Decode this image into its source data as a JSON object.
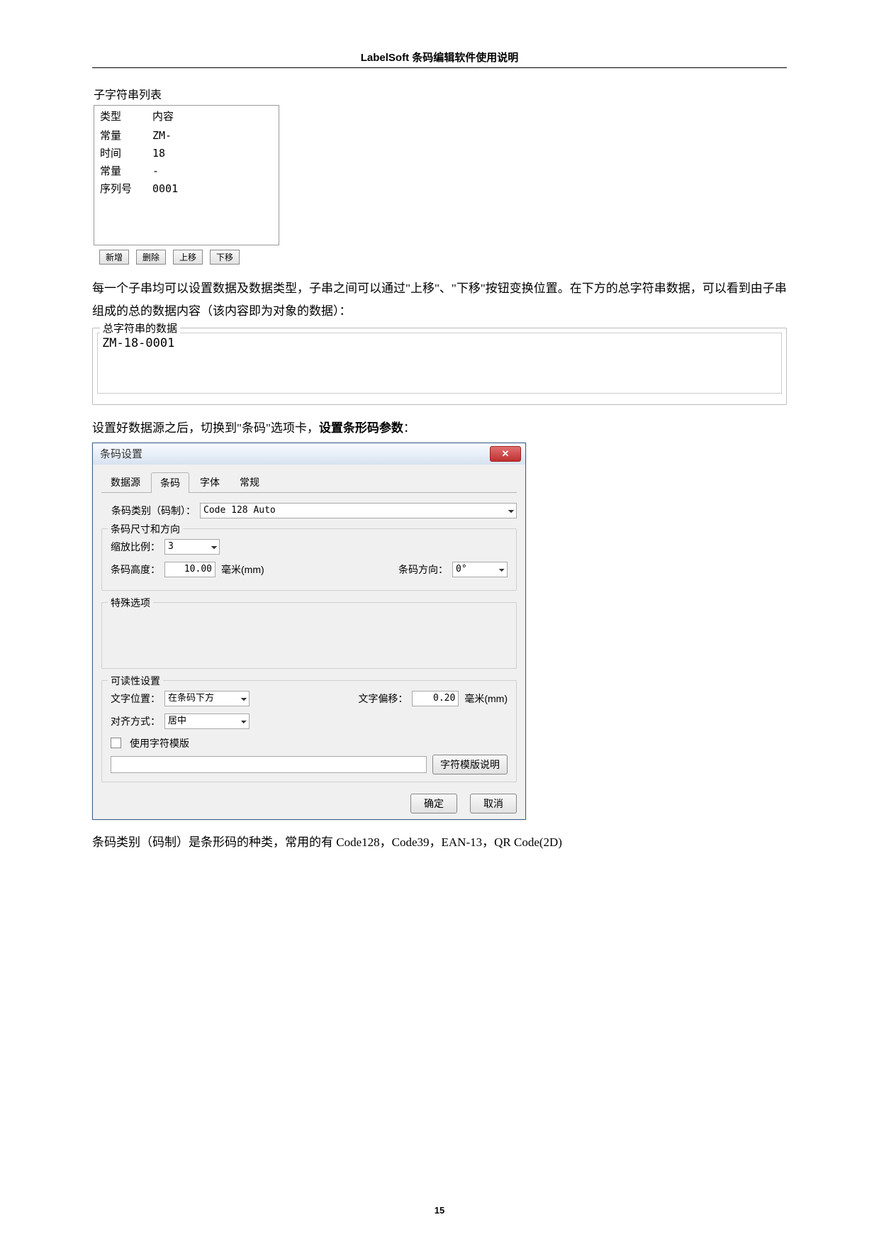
{
  "header": "LabelSoft 条码编辑软件使用说明",
  "substring": {
    "title": "子字符串列表",
    "columns": {
      "type": "类型",
      "content": "内容"
    },
    "rows": [
      {
        "type": "常量",
        "content": "ZM-"
      },
      {
        "type": "时间",
        "content": "18"
      },
      {
        "type": "常量",
        "content": "-"
      },
      {
        "type": "序列号",
        "content": "0001"
      }
    ],
    "buttons": {
      "add": "新增",
      "delete": "删除",
      "up": "上移",
      "down": "下移"
    }
  },
  "para1": "每一个子串均可以设置数据及数据类型，子串之间可以通过\"上移\"、\"下移\"按钮变换位置。在下方的总字符串数据，可以看到由子串组成的总的数据内容（该内容即为对象的数据）：",
  "total": {
    "legend": "总字符串的数据",
    "value": "ZM-18-0001"
  },
  "midline": {
    "plain": "设置好数据源之后，切换到\"条码\"选项卡，",
    "bold": "设置条形码参数",
    "tail": "："
  },
  "dialog": {
    "title": "条码设置",
    "closeName": "close-icon",
    "tabs": {
      "data": "数据源",
      "barcode": "条码",
      "font": "字体",
      "general": "常规"
    },
    "type": {
      "label": "条码类别（码制）：",
      "value": "Code 128 Auto"
    },
    "size": {
      "legend": "条码尺寸和方向",
      "scale_label": "缩放比例：",
      "scale_value": "3",
      "height_label": "条码高度：",
      "height_value": "10.00",
      "height_unit": "毫米(mm)",
      "dir_label": "条码方向：",
      "dir_value": "0°"
    },
    "special": {
      "legend": "特殊选项"
    },
    "readable": {
      "legend": "可读性设置",
      "pos_label": "文字位置：",
      "pos_value": "在条码下方",
      "offset_label": "文字偏移：",
      "offset_value": "0.20",
      "offset_unit": "毫米(mm)",
      "align_label": "对齐方式：",
      "align_value": "居中",
      "use_template": "使用字符模版",
      "template_help": "字符模版说明"
    },
    "buttons": {
      "ok": "确定",
      "cancel": "取消"
    }
  },
  "para2": "条码类别（码制）是条形码的种类，常用的有 Code128，Code39，EAN-13，QR Code(2D)",
  "page_number": "15"
}
